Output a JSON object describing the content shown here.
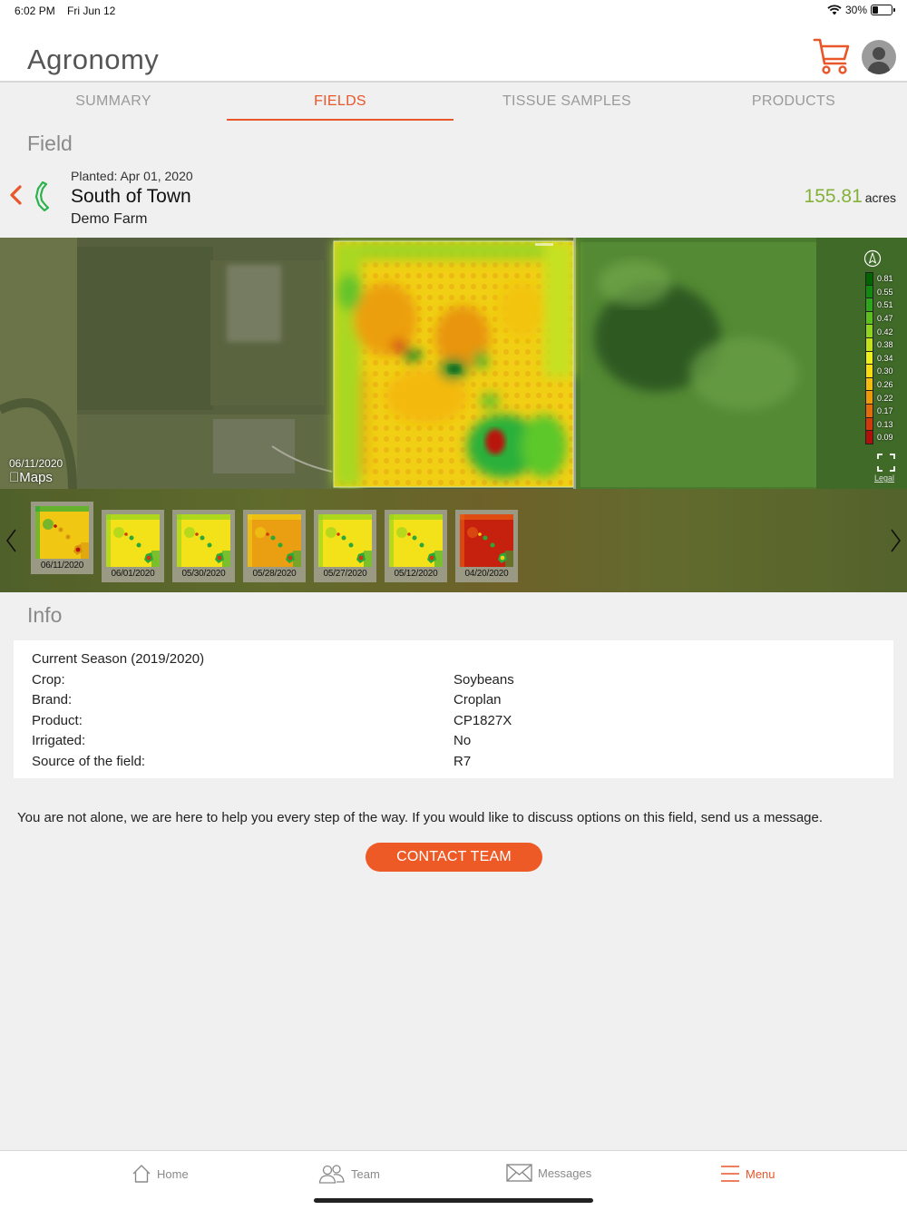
{
  "status_bar": {
    "time": "6:02 PM",
    "date": "Fri Jun 12",
    "battery": "30%",
    "battery_level": 0.3
  },
  "header": {
    "title": "Agronomy"
  },
  "tabs": [
    {
      "label": "SUMMARY"
    },
    {
      "label": "FIELDS"
    },
    {
      "label": "TISSUE SAMPLES"
    },
    {
      "label": "PRODUCTS"
    }
  ],
  "active_tab": "FIELDS",
  "field_section": {
    "title": "Field"
  },
  "field": {
    "planted": "Planted:  Apr 01, 2020",
    "name": "South of Town",
    "farm": "Demo Farm",
    "acres_value": "155.81",
    "acres_unit": "acres"
  },
  "map": {
    "date": "06/11/2020",
    "provider": "Maps",
    "legal": "Legal",
    "legend": [
      {
        "value": "0.81",
        "color": "#006400"
      },
      {
        "value": "0.55",
        "color": "#128a12"
      },
      {
        "value": "0.51",
        "color": "#2ea61c"
      },
      {
        "value": "0.47",
        "color": "#5cbf1e"
      },
      {
        "value": "0.42",
        "color": "#8fd41e"
      },
      {
        "value": "0.38",
        "color": "#c4e21a"
      },
      {
        "value": "0.34",
        "color": "#eef01c"
      },
      {
        "value": "0.30",
        "color": "#f6dc10"
      },
      {
        "value": "0.26",
        "color": "#f2bd0c"
      },
      {
        "value": "0.22",
        "color": "#ec9a0a"
      },
      {
        "value": "0.17",
        "color": "#e26c0a"
      },
      {
        "value": "0.13",
        "color": "#d03a0a"
      },
      {
        "value": "0.09",
        "color": "#b0100a"
      }
    ]
  },
  "thumbnails": [
    {
      "date": "06/11/2020",
      "tone": "mixed"
    },
    {
      "date": "06/01/2020",
      "tone": "yellow"
    },
    {
      "date": "05/30/2020",
      "tone": "yellow"
    },
    {
      "date": "05/28/2020",
      "tone": "orange"
    },
    {
      "date": "05/27/2020",
      "tone": "yellow"
    },
    {
      "date": "05/12/2020",
      "tone": "yellow"
    },
    {
      "date": "04/20/2020",
      "tone": "red"
    }
  ],
  "info_section": {
    "title": "Info"
  },
  "info": {
    "season": "Current Season (2019/2020)",
    "rows": [
      {
        "label": "Crop:",
        "value": "Soybeans"
      },
      {
        "label": "Brand:",
        "value": "Croplan"
      },
      {
        "label": "Product:",
        "value": "CP1827X"
      },
      {
        "label": "Irrigated:",
        "value": "No"
      },
      {
        "label": "Source of the field:",
        "value": "R7"
      }
    ]
  },
  "help_text": "You are not alone, we are here to help you every step of the way. If you would like to discuss options on this field, send us a message.",
  "contact_button": "CONTACT TEAM",
  "bottom_nav": [
    {
      "label": "Home",
      "icon": "home-icon"
    },
    {
      "label": "Team",
      "icon": "team-icon"
    },
    {
      "label": "Messages",
      "icon": "envelope-icon"
    },
    {
      "label": "Menu",
      "icon": "menu-icon"
    }
  ],
  "colors": {
    "accent": "#e8562a",
    "acres": "#84b13a",
    "field_icon": "#2bb24c"
  }
}
